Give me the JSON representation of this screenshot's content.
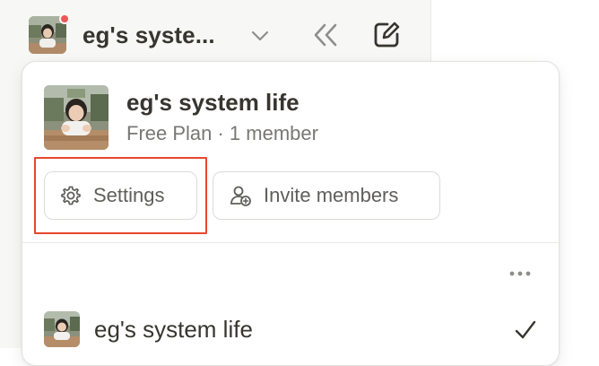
{
  "switcher": {
    "workspace_name": "eg's syste...",
    "avatar_icon": "photo-avatar",
    "notification_color": "#eb5757",
    "dropdown_icon": "chevron-down-icon",
    "collapse_icon": "double-chevron-left-icon",
    "compose_icon": "new-page-icon"
  },
  "popup": {
    "title": "eg's system life",
    "subtitle": "Free Plan · 1 member",
    "settings_label": "Settings",
    "invite_label": "Invite members",
    "more_icon": "ellipsis-icon",
    "highlight_color": "#e8472e"
  },
  "workspaces": [
    {
      "name": "eg's system life",
      "selected": true
    }
  ]
}
